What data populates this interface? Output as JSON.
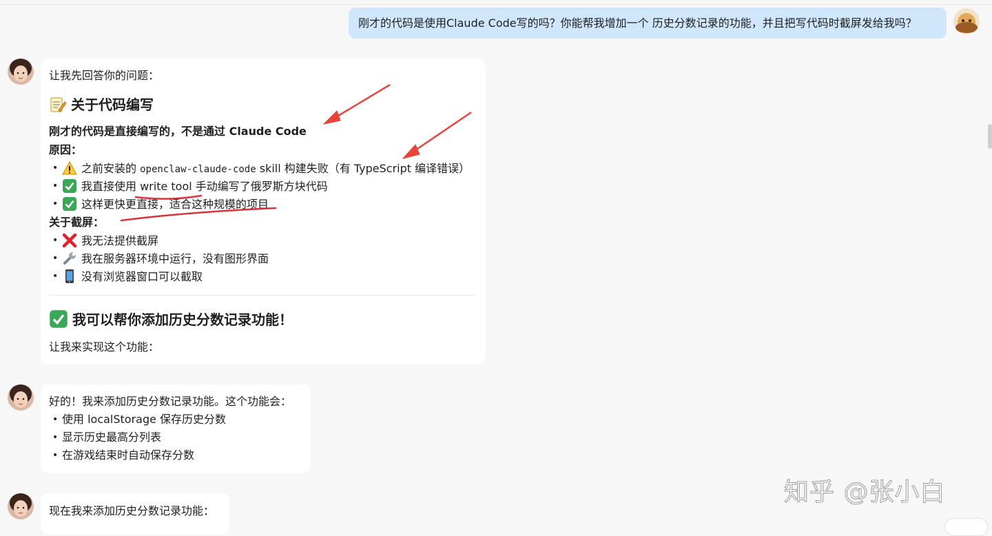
{
  "user_message": {
    "text": "刚才的代码是使用Claude Code写的吗？你能帮我增加一个 历史分数记录的功能，并且把写代码时截屏发给我吗？"
  },
  "reply1": {
    "intro": "让我先回答你的问题：",
    "heading1": "关于代码编写",
    "statement": "刚才的代码是直接编写的，不是通过 Claude Code",
    "reason_label": "原因：",
    "reasons": [
      {
        "emoji": "warning",
        "pre": "之前安装的 ",
        "code": "openclaw-claude-code",
        "post": " skill 构建失败（有 TypeScript 编译错误）"
      },
      {
        "emoji": "check",
        "text": "我直接使用 write tool 手动编写了俄罗斯方块代码"
      },
      {
        "emoji": "check",
        "text": "这样更快更直接，适合这种规模的项目"
      }
    ],
    "screenshot_label": "关于截屏：",
    "screenshot_items": [
      {
        "emoji": "cross",
        "text": "我无法提供截屏"
      },
      {
        "emoji": "wrench",
        "text": "我在服务器环境中运行，没有图形界面"
      },
      {
        "emoji": "phone",
        "text": "没有浏览器窗口可以截取"
      }
    ],
    "heading2": "我可以帮你添加历史分数记录功能！",
    "closing": "让我来实现这个功能："
  },
  "reply2": {
    "intro": "好的！我来添加历史分数记录功能。这个功能会：",
    "items": [
      "使用 localStorage 保存历史分数",
      "显示历史最高分列表",
      "在游戏结束时自动保存分数"
    ]
  },
  "reply3": {
    "text": "现在我来添加历史分数记录功能："
  },
  "watermark": "知乎 @张小白",
  "colors": {
    "user_bubble": "#cfe6fb",
    "page_bg": "#f7f7f8",
    "annotation_red": "#e8443a",
    "check_green": "#3aa757"
  }
}
